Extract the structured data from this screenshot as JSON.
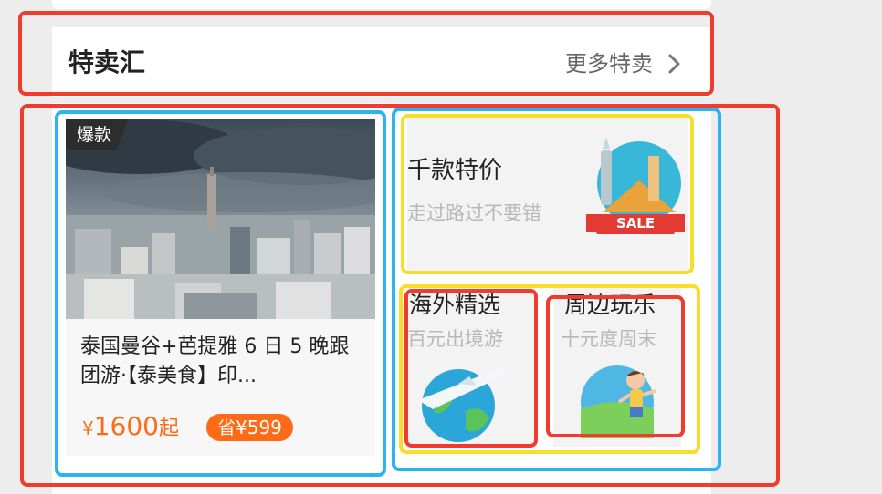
{
  "section": {
    "title": "特卖汇",
    "more_label": "更多特卖"
  },
  "product": {
    "badge": "爆款",
    "title": "泰国曼谷+芭提雅 6 日 5 晚跟团游·【泰美食】印...",
    "price_currency": "¥",
    "price_value": "1600",
    "price_suffix": "起",
    "save_label": "省¥599"
  },
  "promos": {
    "main": {
      "title": "千款特价",
      "subtitle": "走过路过不要错",
      "badge_text": "SALE"
    },
    "overseas": {
      "title": "海外精选",
      "subtitle": "百元出境游"
    },
    "nearby": {
      "title": "周边玩乐",
      "subtitle": "十元度周末"
    }
  },
  "colors": {
    "accent": "#ff6a16",
    "annotation_red": "#f03c2e",
    "annotation_blue": "#2bb4ef",
    "annotation_yellow": "#f9dc2c"
  },
  "icons": {
    "more": "chevron-right-icon",
    "main_promo": "statue-of-liberty-sale-icon",
    "overseas": "airplane-globe-icon",
    "nearby": "running-girl-icon"
  }
}
